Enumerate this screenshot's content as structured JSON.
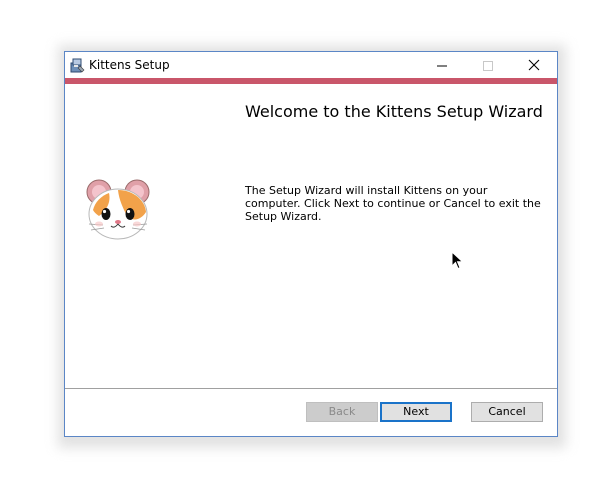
{
  "window": {
    "title": "Kittens Setup"
  },
  "titlebar": {
    "icons": [
      "installer-app-icon",
      "minimize-icon",
      "maximize-icon",
      "close-icon"
    ]
  },
  "colors": {
    "accent_bar": "#c9566a",
    "window_border": "#5b86c6",
    "next_focus_border": "#1a73c9"
  },
  "main": {
    "heading": "Welcome to the Kittens Setup Wizard",
    "body": "The Setup Wizard will install Kittens on your computer. Click Next to continue or Cancel to exit the Setup Wizard.",
    "image_icon": "hamster-face-icon"
  },
  "buttons": {
    "back": "Back",
    "next": "Next",
    "cancel": "Cancel"
  }
}
